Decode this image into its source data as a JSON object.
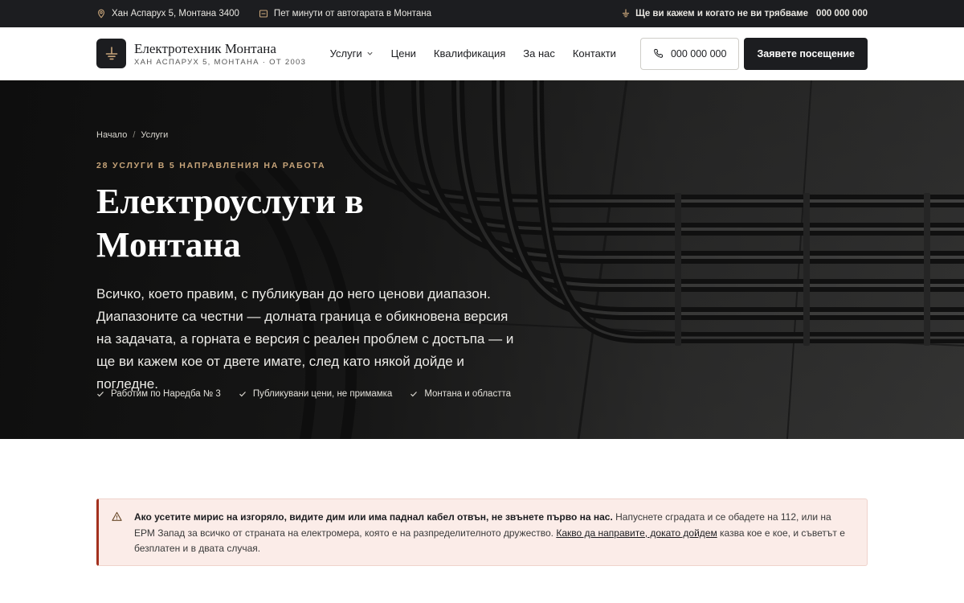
{
  "topbar": {
    "address": "Хан Аспарух 5, Монтана 3400",
    "location_note": "Пет минути от автогарата в Монтана",
    "promise": "Ще ви кажем и когато не ви трябваме",
    "phone": "000 000 000"
  },
  "brand": {
    "name": "Електротехник Монтана",
    "tagline": "ХАН АСПАРУХ 5, МОНТАНА · ОТ 2003"
  },
  "nav": {
    "items": [
      {
        "label": "Услуги",
        "has_dropdown": true
      },
      {
        "label": "Цени"
      },
      {
        "label": "Квалификация"
      },
      {
        "label": "За нас"
      },
      {
        "label": "Контакти"
      }
    ],
    "phone_button": "000 000 000",
    "cta_button": "Заявете посещение"
  },
  "hero": {
    "breadcrumb": [
      "Начало",
      "Услуги"
    ],
    "eyebrow": "28 УСЛУГИ В 5 НАПРАВЛЕНИЯ НА РАБОТА",
    "title": "Електроуслуги в Монтана",
    "lead": "Всичко, което правим, с публикуван до него ценови диапазон. Диапазоните са честни — долната граница е обикновена версия на задачата, а горната е версия с реален проблем с достъпа — и ще ви кажем кое от двете имате, след като някой дойде и погледне.",
    "checks": [
      "Работим по Наредба № 3",
      "Публикувани цени, не примамка",
      "Монтана и областта"
    ]
  },
  "alert": {
    "bold": "Ако усетите мирис на изгоряло, видите дим или има паднал кабел отвън, не звънете първо на нас.",
    "text_1": " Напуснете сградата и се обадете на 112, или на ЕРМ Запад за всичко от страната на електромера, която е на разпределителното дружество. ",
    "link": "Какво да направите, докато дойдем",
    "text_2": " казва кое е кое, и съветът е безплатен и в двата случая."
  },
  "colors": {
    "dark": "#1c1d20",
    "accent": "#c8a57a",
    "alert_bg": "#fbece8",
    "alert_border": "#a3311e"
  },
  "icons": [
    "map-pin-icon",
    "location-icon",
    "ground-icon",
    "phone-icon",
    "chevron-down-icon",
    "check-icon",
    "warning-icon"
  ]
}
